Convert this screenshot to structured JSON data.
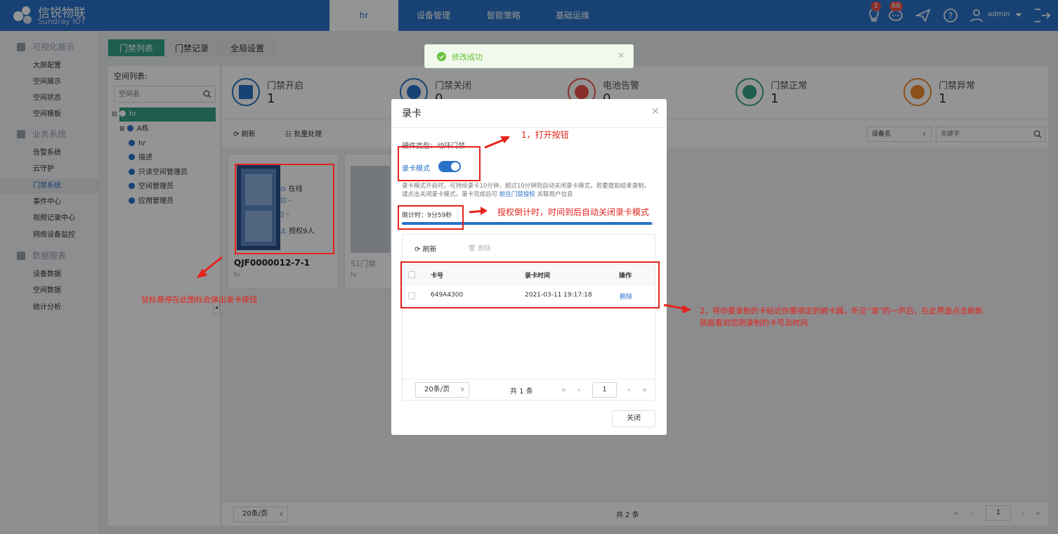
{
  "header": {
    "brand_cn": "信锐物联",
    "brand_en": "Sundray IOT",
    "nav": [
      {
        "label": "hr"
      },
      {
        "label": "设备管理"
      },
      {
        "label": "智能策略"
      },
      {
        "label": "基础运维"
      }
    ],
    "badge_bulb": "1",
    "badge_msg": "68",
    "user": "admin"
  },
  "sidebar": {
    "groups": [
      {
        "label": "可视化展示",
        "items": [
          "大屏配置",
          "空间展示",
          "空间状态",
          "空间模板"
        ]
      },
      {
        "label": "业务系统",
        "items": [
          "告警系统",
          "云守护",
          "门禁系统",
          "事件中心",
          "视频记录中心",
          "网络设备监控"
        ]
      },
      {
        "label": "数据报表",
        "items": [
          "设备数据",
          "空间数据",
          "统计分析"
        ]
      }
    ]
  },
  "page_tabs": [
    "门禁列表",
    "门禁记录",
    "全局设置"
  ],
  "tree": {
    "title": "空间列表:",
    "search_placeholder": "空间名",
    "nodes": [
      "hr",
      "A栋",
      "hr",
      "描述",
      "只读空间管理员",
      "空间管理员",
      "应用管理员"
    ]
  },
  "stats": [
    {
      "label": "门禁开启",
      "value": "1",
      "color": "#2a72c8"
    },
    {
      "label": "门禁关闭",
      "value": "0",
      "color": "#2a72c8"
    },
    {
      "label": "电池告警",
      "value": "0",
      "color": "#e8544b"
    },
    {
      "label": "门禁正常",
      "value": "1",
      "color": "#36a287"
    },
    {
      "label": "门禁异常",
      "value": "1",
      "color": "#f08c2e"
    }
  ],
  "toolbar": {
    "refresh": "刷新",
    "batch": "批量处理",
    "filter_select": "设备名",
    "keyword_placeholder": "关键字"
  },
  "devices": [
    {
      "name": "QJF0000012-7-1",
      "space": "hr",
      "status": "在线",
      "field2": "-",
      "field3": "-",
      "auth": "授权9人"
    },
    {
      "name": "S1门禁",
      "space": "hr"
    }
  ],
  "footer": {
    "page_size": "20条/页",
    "total": "共 2 条",
    "page": "1"
  },
  "toast": {
    "text": "修改成功"
  },
  "modal": {
    "title": "录卡",
    "hw_type": "硬件类型：动环门禁",
    "toggle_label": "录卡模式",
    "toggle_on": true,
    "desc": "录卡模式开启时，可持续录卡10分钟，超过10分钟则自动关闭录卡模式，若要提前结束录制，请点击关闭录卡模式。录卡完成后可",
    "desc_link": "前往门禁授权",
    "desc_tail": "关联用户信息",
    "countdown": "倒计时：9分59秒",
    "progress": 0.99,
    "refresh": "刷新",
    "delete": "删除",
    "columns": [
      "卡号",
      "录卡时间",
      "操作"
    ],
    "rows": [
      {
        "card": "649A4300",
        "time": "2021-03-11 19:17:18",
        "action": "删除"
      }
    ],
    "page_size": "20条/页",
    "total": "共 1 条",
    "page": "1",
    "close": "关闭"
  },
  "annotations": {
    "a1": "1，打开按钮",
    "a2": "授权倒计时，时间到后自动关闭录卡模式",
    "a3": "鼠标悬停在此图标会弹出录卡按钮",
    "a4_l1": "2，将你要录制的卡贴近你要绑定的刷卡器，听见“滴”的一声后，在此界面点击刷新",
    "a4_l2": "就能看到您刚录制的卡号及时间"
  }
}
